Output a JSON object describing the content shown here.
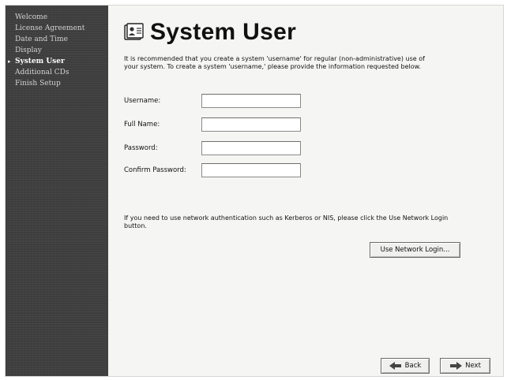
{
  "sidebar": {
    "items": [
      {
        "label": "Welcome",
        "active": false
      },
      {
        "label": "License Agreement",
        "active": false
      },
      {
        "label": "Date and Time",
        "active": false
      },
      {
        "label": "Display",
        "active": false
      },
      {
        "label": "System User",
        "active": true
      },
      {
        "label": "Additional CDs",
        "active": false
      },
      {
        "label": "Finish Setup",
        "active": false
      }
    ],
    "active_marker": "▸"
  },
  "main": {
    "title": "System User",
    "title_icon": "users-icon",
    "intro": "It is recommended that you create a system 'username' for regular (non-administrative) use of your system. To create a system 'username,' please provide the information requested below.",
    "form": {
      "username_label": "Username:",
      "username_value": "",
      "fullname_label": "Full Name:",
      "fullname_value": "",
      "password_label": "Password:",
      "password_value": "",
      "confirm_label": "Confirm Password:",
      "confirm_value": ""
    },
    "network_note": "If you need to use network authentication such as Kerberos or NIS, please click the Use Network Login button.",
    "network_login_label": "Use Network Login..."
  },
  "footer": {
    "back_label": "Back",
    "next_label": "Next",
    "back_icon": "arrow-left-icon",
    "next_icon": "arrow-right-icon"
  },
  "colors": {
    "sidebar_bg": "#3f3f3f",
    "content_bg": "#f5f5f3",
    "accent_text": "#ffffff"
  }
}
